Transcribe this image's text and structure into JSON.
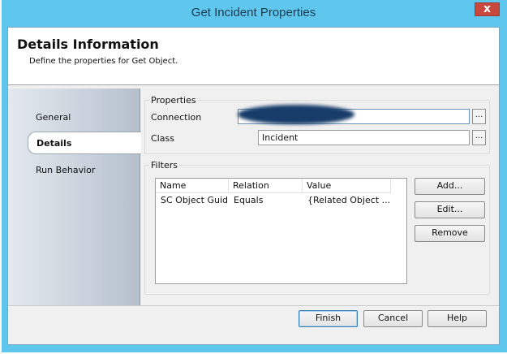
{
  "window": {
    "title": "Get Incident Properties",
    "close_glyph": "x"
  },
  "header": {
    "title": "Details Information",
    "subtitle": "Define the properties for Get Object."
  },
  "nav": {
    "items": [
      {
        "label": "General"
      },
      {
        "label": "Details"
      },
      {
        "label": "Run Behavior"
      }
    ]
  },
  "properties": {
    "group_label": "Properties",
    "connection_label": "Connection",
    "connection_value": "",
    "class_label": "Class",
    "class_value": "Incident",
    "browse_glyph": "..."
  },
  "filters": {
    "group_label": "Filters",
    "columns": [
      "Name",
      "Relation",
      "Value"
    ],
    "rows": [
      {
        "name": "SC Object Guid",
        "relation": "Equals",
        "value": "{Related Object ..."
      }
    ],
    "add_label": "Add...",
    "edit_label": "Edit...",
    "remove_label": "Remove"
  },
  "footer": {
    "finish_label": "Finish",
    "cancel_label": "Cancel",
    "help_label": "Help"
  },
  "colors": {
    "title_bar": "#5fc6ee",
    "close_button": "#c9483d",
    "redaction": "#173c69"
  }
}
